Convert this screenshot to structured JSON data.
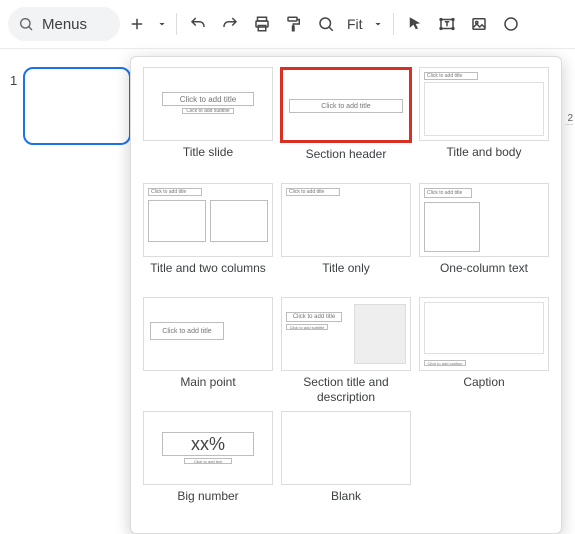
{
  "toolbar": {
    "search_text": "Menus",
    "zoom_label": "Fit"
  },
  "filmstrip": {
    "slides": [
      {
        "number": "1"
      }
    ]
  },
  "layouts": [
    {
      "id": "title-slide",
      "label": "Title slide",
      "title_ph": "Click to add title",
      "subtitle_ph": "Click to add subtitle"
    },
    {
      "id": "section-header",
      "label": "Section header",
      "title_ph": "Click to add title",
      "highlighted": true
    },
    {
      "id": "title-and-body",
      "label": "Title and body",
      "title_ph": "Click to add title"
    },
    {
      "id": "title-and-two-columns",
      "label": "Title and two columns",
      "title_ph": "Click to add title"
    },
    {
      "id": "title-only",
      "label": "Title only",
      "title_ph": "Click to add title"
    },
    {
      "id": "one-column-text",
      "label": "One-column text",
      "title_ph": "Click to add title"
    },
    {
      "id": "main-point",
      "label": "Main point",
      "title_ph": "Click to add title"
    },
    {
      "id": "section-title-and-description",
      "label": "Section title and description",
      "title_ph": "Click to add title",
      "subtitle_ph": "Click to add subtitle"
    },
    {
      "id": "caption",
      "label": "Caption",
      "caption_ph": "Click to add caption"
    },
    {
      "id": "big-number",
      "label": "Big number",
      "title_ph": "xx%",
      "subtitle_ph": "Click to add text"
    },
    {
      "id": "blank",
      "label": "Blank"
    }
  ],
  "ruler": {
    "tick": "2"
  }
}
